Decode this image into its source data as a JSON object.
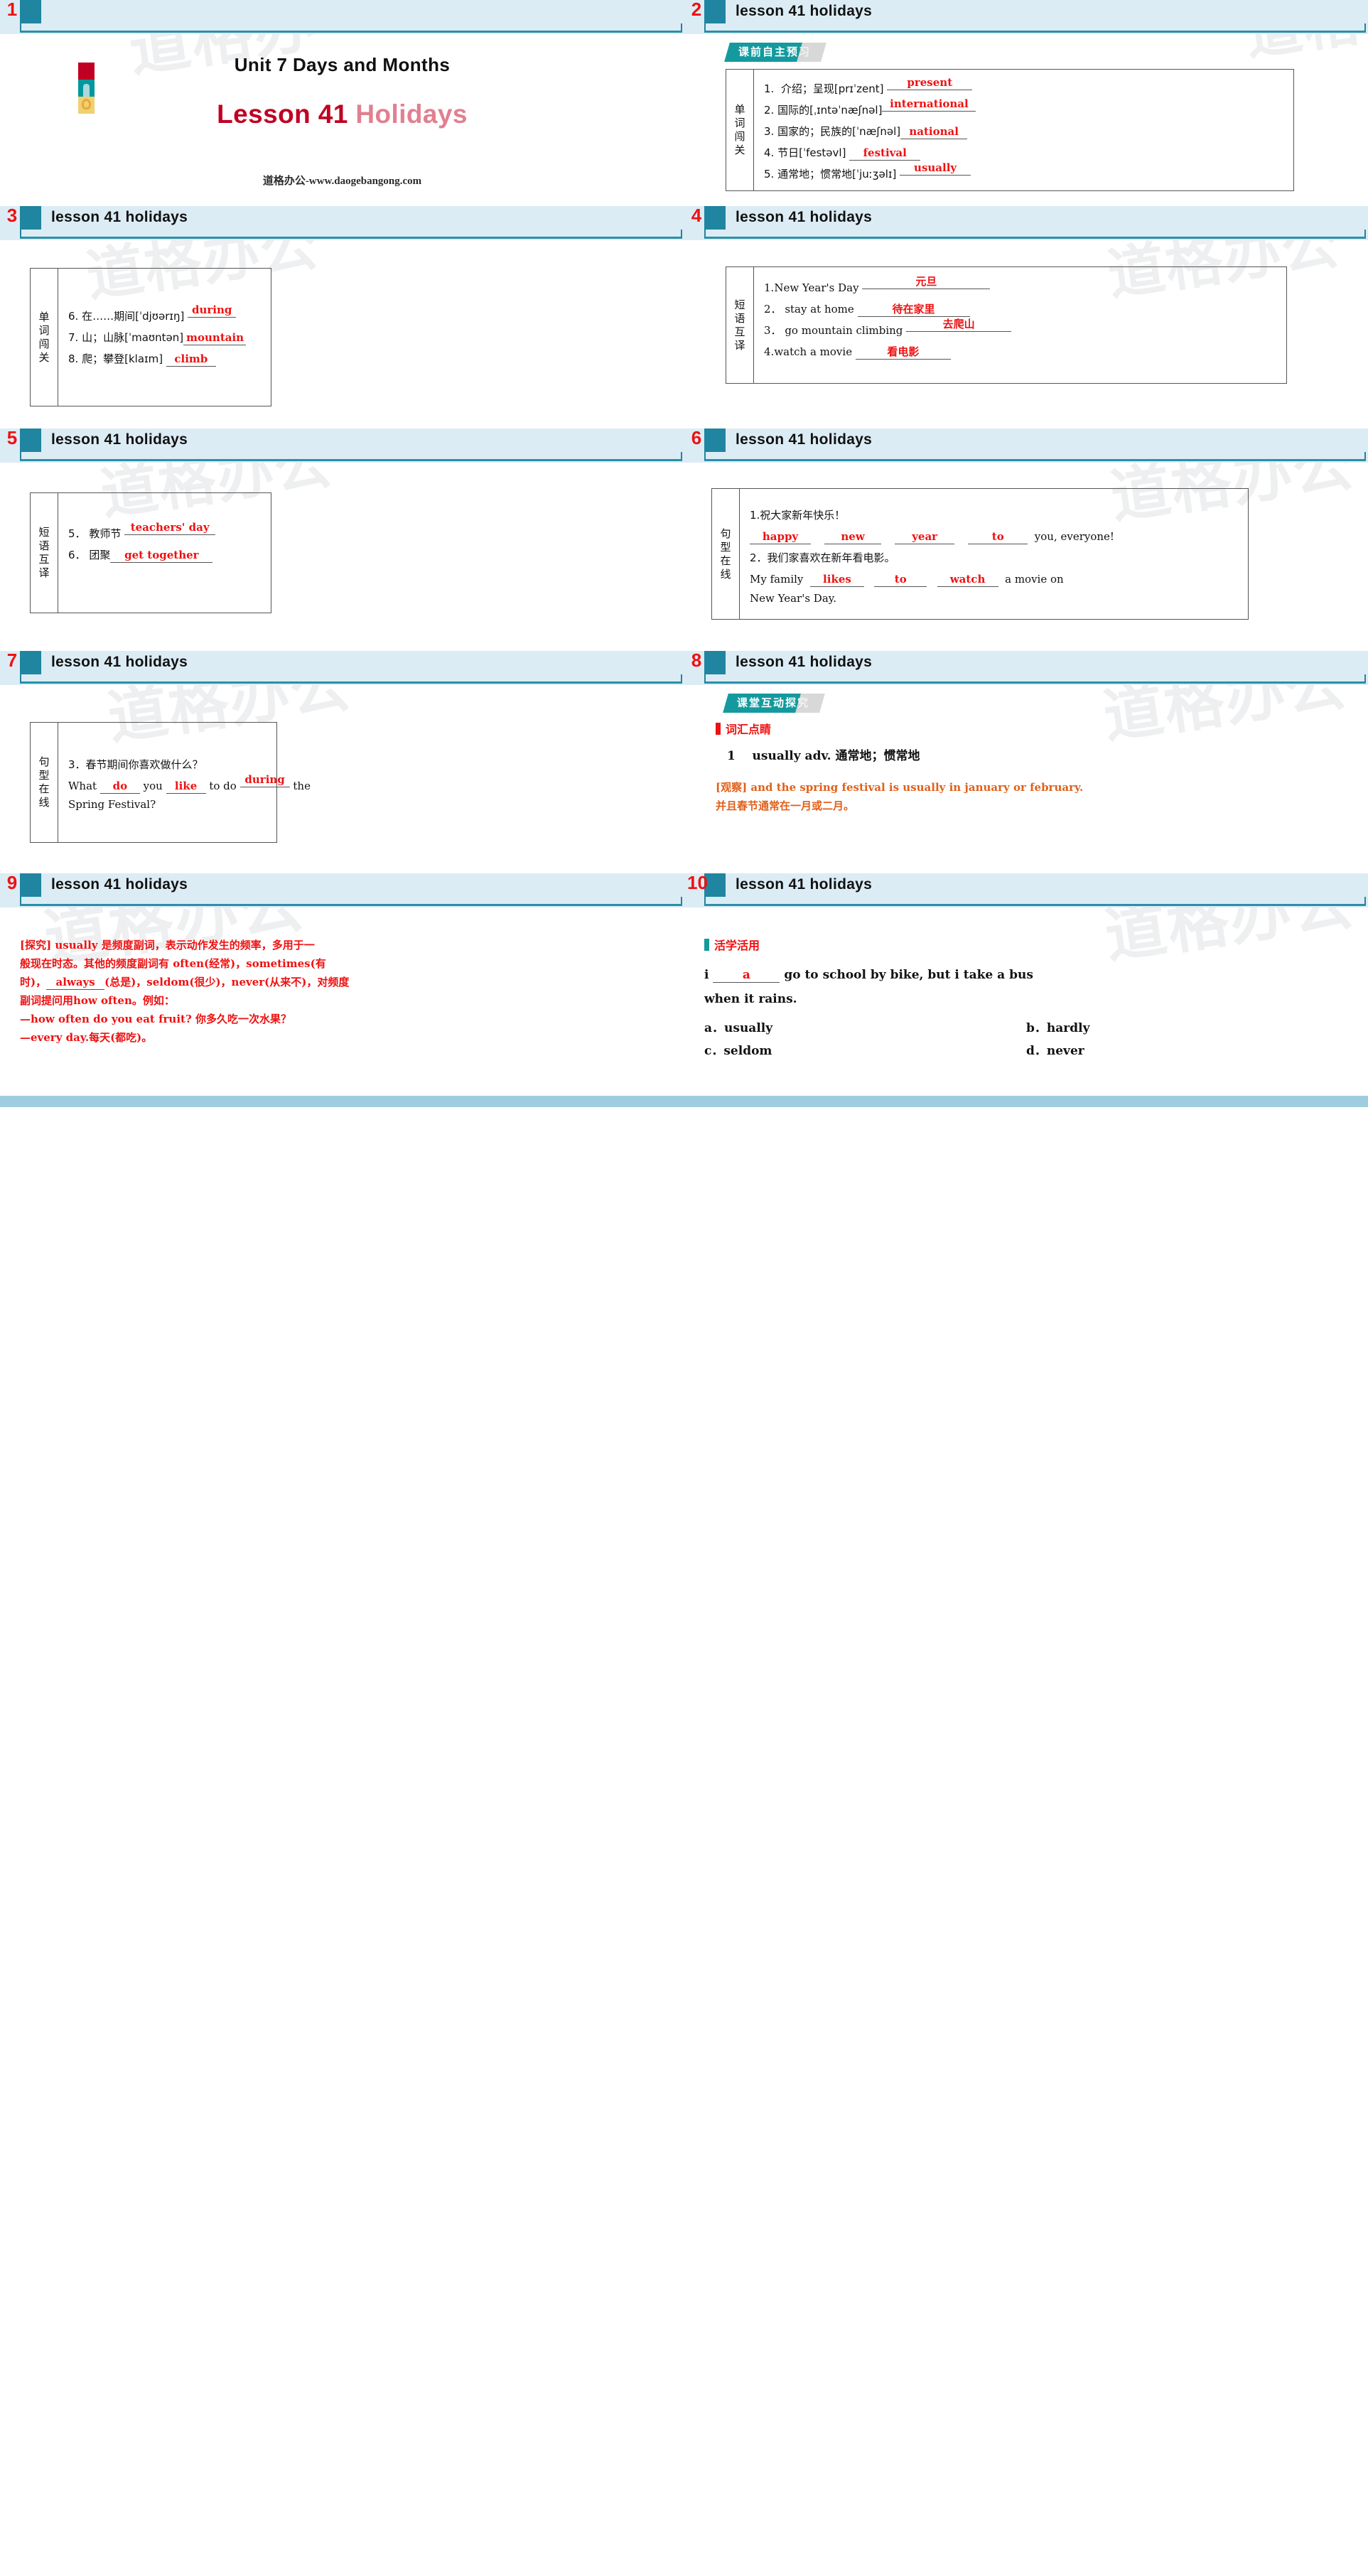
{
  "deck": {
    "brand_site": "道格办公-www.daogebangong.com",
    "watermark": "道格办公",
    "colors": {
      "header_band": "#dcecf5",
      "header_tab": "#1f85a0",
      "slide_number": "#ee1111",
      "answer_red": "#ee1111",
      "badge_teal": "#149a9e",
      "title_red": "#c00022",
      "orange": "#e0601a"
    }
  },
  "slides": [
    {
      "number": "1",
      "type": "title",
      "header_title": "",
      "unit_title": "Unit 7  Days and Months",
      "lesson_title_a": "Lesson 41 ",
      "lesson_title_b": "Holidays",
      "site": "道格办公-www.daogebangong.com"
    },
    {
      "number": "2",
      "type": "vocab",
      "header_title": "lesson 41   holidays",
      "badge": "课前自主预习",
      "badge_main": "课前自主预",
      "badge_tail": "习",
      "box_label": "单词闯关",
      "rows": [
        {
          "num": "1.",
          "cn": "介绍；呈现",
          "ipa": "[prɪˈzent]",
          "answer": "present"
        },
        {
          "num": "2.",
          "cn": "国际的",
          "ipa": "[ˌɪntəˈnæʃnəl]",
          "answer": "international"
        },
        {
          "num": "3.",
          "cn": "国家的；民族的",
          "ipa": "[ˈnæʃnəl]",
          "answer": "national"
        },
        {
          "num": "4.",
          "cn": "节日",
          "ipa": "[ˈfestəvl]",
          "answer": "festival"
        },
        {
          "num": "5.",
          "cn": "通常地；惯常地",
          "ipa": "[ˈjuːʒəlɪ]",
          "answer": "usually"
        }
      ]
    },
    {
      "number": "3",
      "type": "vocab",
      "header_title": "lesson 41   holidays",
      "box_label": "单词闯关",
      "rows": [
        {
          "num": "6.",
          "cn": "在……期间",
          "ipa": "[ˈdjʊərɪŋ]",
          "answer": "during"
        },
        {
          "num": "7.",
          "cn": "山；山脉",
          "ipa": "[ˈmaʊntən]",
          "answer": "mountain"
        },
        {
          "num": "8.",
          "cn": "爬；攀登",
          "ipa": "[klaɪm]",
          "answer": "climb"
        }
      ]
    },
    {
      "number": "4",
      "type": "phrase",
      "header_title": "lesson 41   holidays",
      "box_label": "短语互译",
      "rows": [
        {
          "num": "1.",
          "en": "New Year's Day",
          "answer": "元旦"
        },
        {
          "num": "2．",
          "en": "stay at home",
          "answer": "待在家里"
        },
        {
          "num": "3．",
          "en": "go mountain climbing",
          "answer": "去爬山"
        },
        {
          "num": "4.",
          "en": "watch a movie",
          "answer": "看电影"
        }
      ]
    },
    {
      "number": "5",
      "type": "phrase",
      "header_title": "lesson 41   holidays",
      "box_label": "短语互译",
      "rows": [
        {
          "num": "5．",
          "en": "教师节",
          "answer": "teachers' day"
        },
        {
          "num": "6．",
          "en": "团聚",
          "answer": "get together"
        }
      ]
    },
    {
      "number": "6",
      "type": "sentence",
      "header_title": "lesson 41   holidays",
      "box_label": "句型在线",
      "q1_prompt": "1.祝大家新年快乐！",
      "q1_answers": [
        "happy",
        "new",
        "year",
        "to"
      ],
      "q1_tail": "you, everyone!",
      "q2_prompt": "2．我们家喜欢在新年看电影。",
      "q2_lead": "My family",
      "q2_answers": [
        "likes",
        "to",
        "watch"
      ],
      "q2_mid": "a movie on",
      "q2_tail": "New Year's Day."
    },
    {
      "number": "7",
      "type": "sentence",
      "header_title": "lesson 41   holidays",
      "box_label": "句型在线",
      "q3_prompt": "3．春节期间你喜欢做什么？",
      "q3_lead": "What",
      "q3_a1": "do",
      "q3_m1": "you",
      "q3_a2": "like",
      "q3_m2": "to do",
      "q3_a3": "during",
      "q3_m3": "the",
      "q3_tail": "Spring  Festival?"
    },
    {
      "number": "8",
      "type": "explain",
      "header_title": "lesson 41   holidays",
      "badge_main": "课堂互动探",
      "badge_tail": "究",
      "section_title": "词汇点睛",
      "item_num": "1",
      "item_text": "usually adv. 通常地；惯常地",
      "observe_en": "[观察] and the spring festival is usually in january or february.",
      "observe_cn": "并且春节通常在一月或二月。"
    },
    {
      "number": "9",
      "type": "note",
      "header_title": "lesson 41   holidays",
      "l1": "[探究] usually 是频度副词，表示动作发生的频率，多用于一",
      "l2": "般现在时态。其他的频度副词有 often(经常)，sometimes(有",
      "l3a": "时)，",
      "l3_ans": "always",
      "l3b": "(总是)，seldom(很少)，never(从来不)，对频度",
      "l4": "副词提问用how often。例如：",
      "l5": "—how often do you eat fruit? 你多久吃一次水果？",
      "l6": "—every day.每天(都吃)。"
    },
    {
      "number": "10",
      "type": "practice",
      "header_title": "lesson 41   holidays",
      "section_title": "活学活用",
      "q_lead": "i",
      "q_answer": "a",
      "q_rest": "go to school by bike, but i take a bus",
      "q_line2": "when it rains.",
      "options": [
        "a．usually",
        "b．hardly",
        "c．seldom",
        "d．never"
      ]
    }
  ]
}
